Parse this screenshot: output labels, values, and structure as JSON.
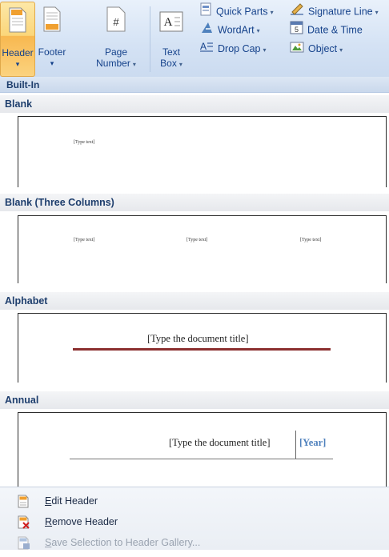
{
  "ribbon": {
    "header": {
      "label": "Header",
      "caret": "▾"
    },
    "footer": {
      "label": "Footer",
      "caret": "▾"
    },
    "page_number": {
      "label1": "Page",
      "label2": "Number",
      "caret": "▾"
    },
    "text_box": {
      "label1": "Text",
      "label2": "Box",
      "caret": "▾"
    },
    "quick_parts": {
      "label": "Quick Parts",
      "caret": "▾"
    },
    "wordart": {
      "label": "WordArt",
      "caret": "▾"
    },
    "drop_cap": {
      "label": "Drop Cap",
      "caret": "▾"
    },
    "signature_line": {
      "label": "Signature Line",
      "caret": "▾"
    },
    "date_time": {
      "label": "Date & Time"
    },
    "object": {
      "label": "Object",
      "caret": "▾"
    },
    "page_number_icon_glyph": "#",
    "text_box_icon_glyph": "A",
    "date_icon_glyph": "5"
  },
  "gallery": {
    "header": "Built-In",
    "sections": [
      {
        "name": "Blank",
        "placeholders": [
          "[Type text]"
        ]
      },
      {
        "name": "Blank (Three Columns)",
        "placeholders": [
          "[Type text]",
          "[Type text]",
          "[Type text]"
        ]
      },
      {
        "name": "Alphabet",
        "title": "[Type the document title]"
      },
      {
        "name": "Annual",
        "title": "[Type the document title]",
        "year": "[Year]"
      }
    ]
  },
  "menu": {
    "edit_header": {
      "mnemonic": "E",
      "rest": "dit Header"
    },
    "remove_header": {
      "mnemonic": "R",
      "rest": "emove Header"
    },
    "save_selection": {
      "mnemonic": "S",
      "rest": "ave Selection to Header Gallery..."
    }
  },
  "colors": {
    "ribbon_text": "#15428b",
    "alphabet_rule": "#8b2f2f",
    "year_blue": "#4f81bd",
    "header_highlight": "#fbd67a"
  }
}
